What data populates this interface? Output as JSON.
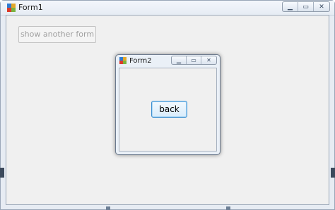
{
  "form1": {
    "title": "Form1",
    "icon": "winforms-app-icon",
    "controls": [
      "minimize-icon",
      "maximize-icon",
      "close-icon"
    ],
    "show_button_label": "show another form"
  },
  "form2": {
    "title": "Form2",
    "icon": "winforms-app-icon",
    "controls": [
      "minimize-icon",
      "maximize-icon",
      "close-icon"
    ],
    "back_button_label": "back"
  },
  "colors": {
    "client_bg": "#f0f0f0",
    "frame": "#e7ecf3",
    "focus_accent": "#3c8fd1"
  }
}
